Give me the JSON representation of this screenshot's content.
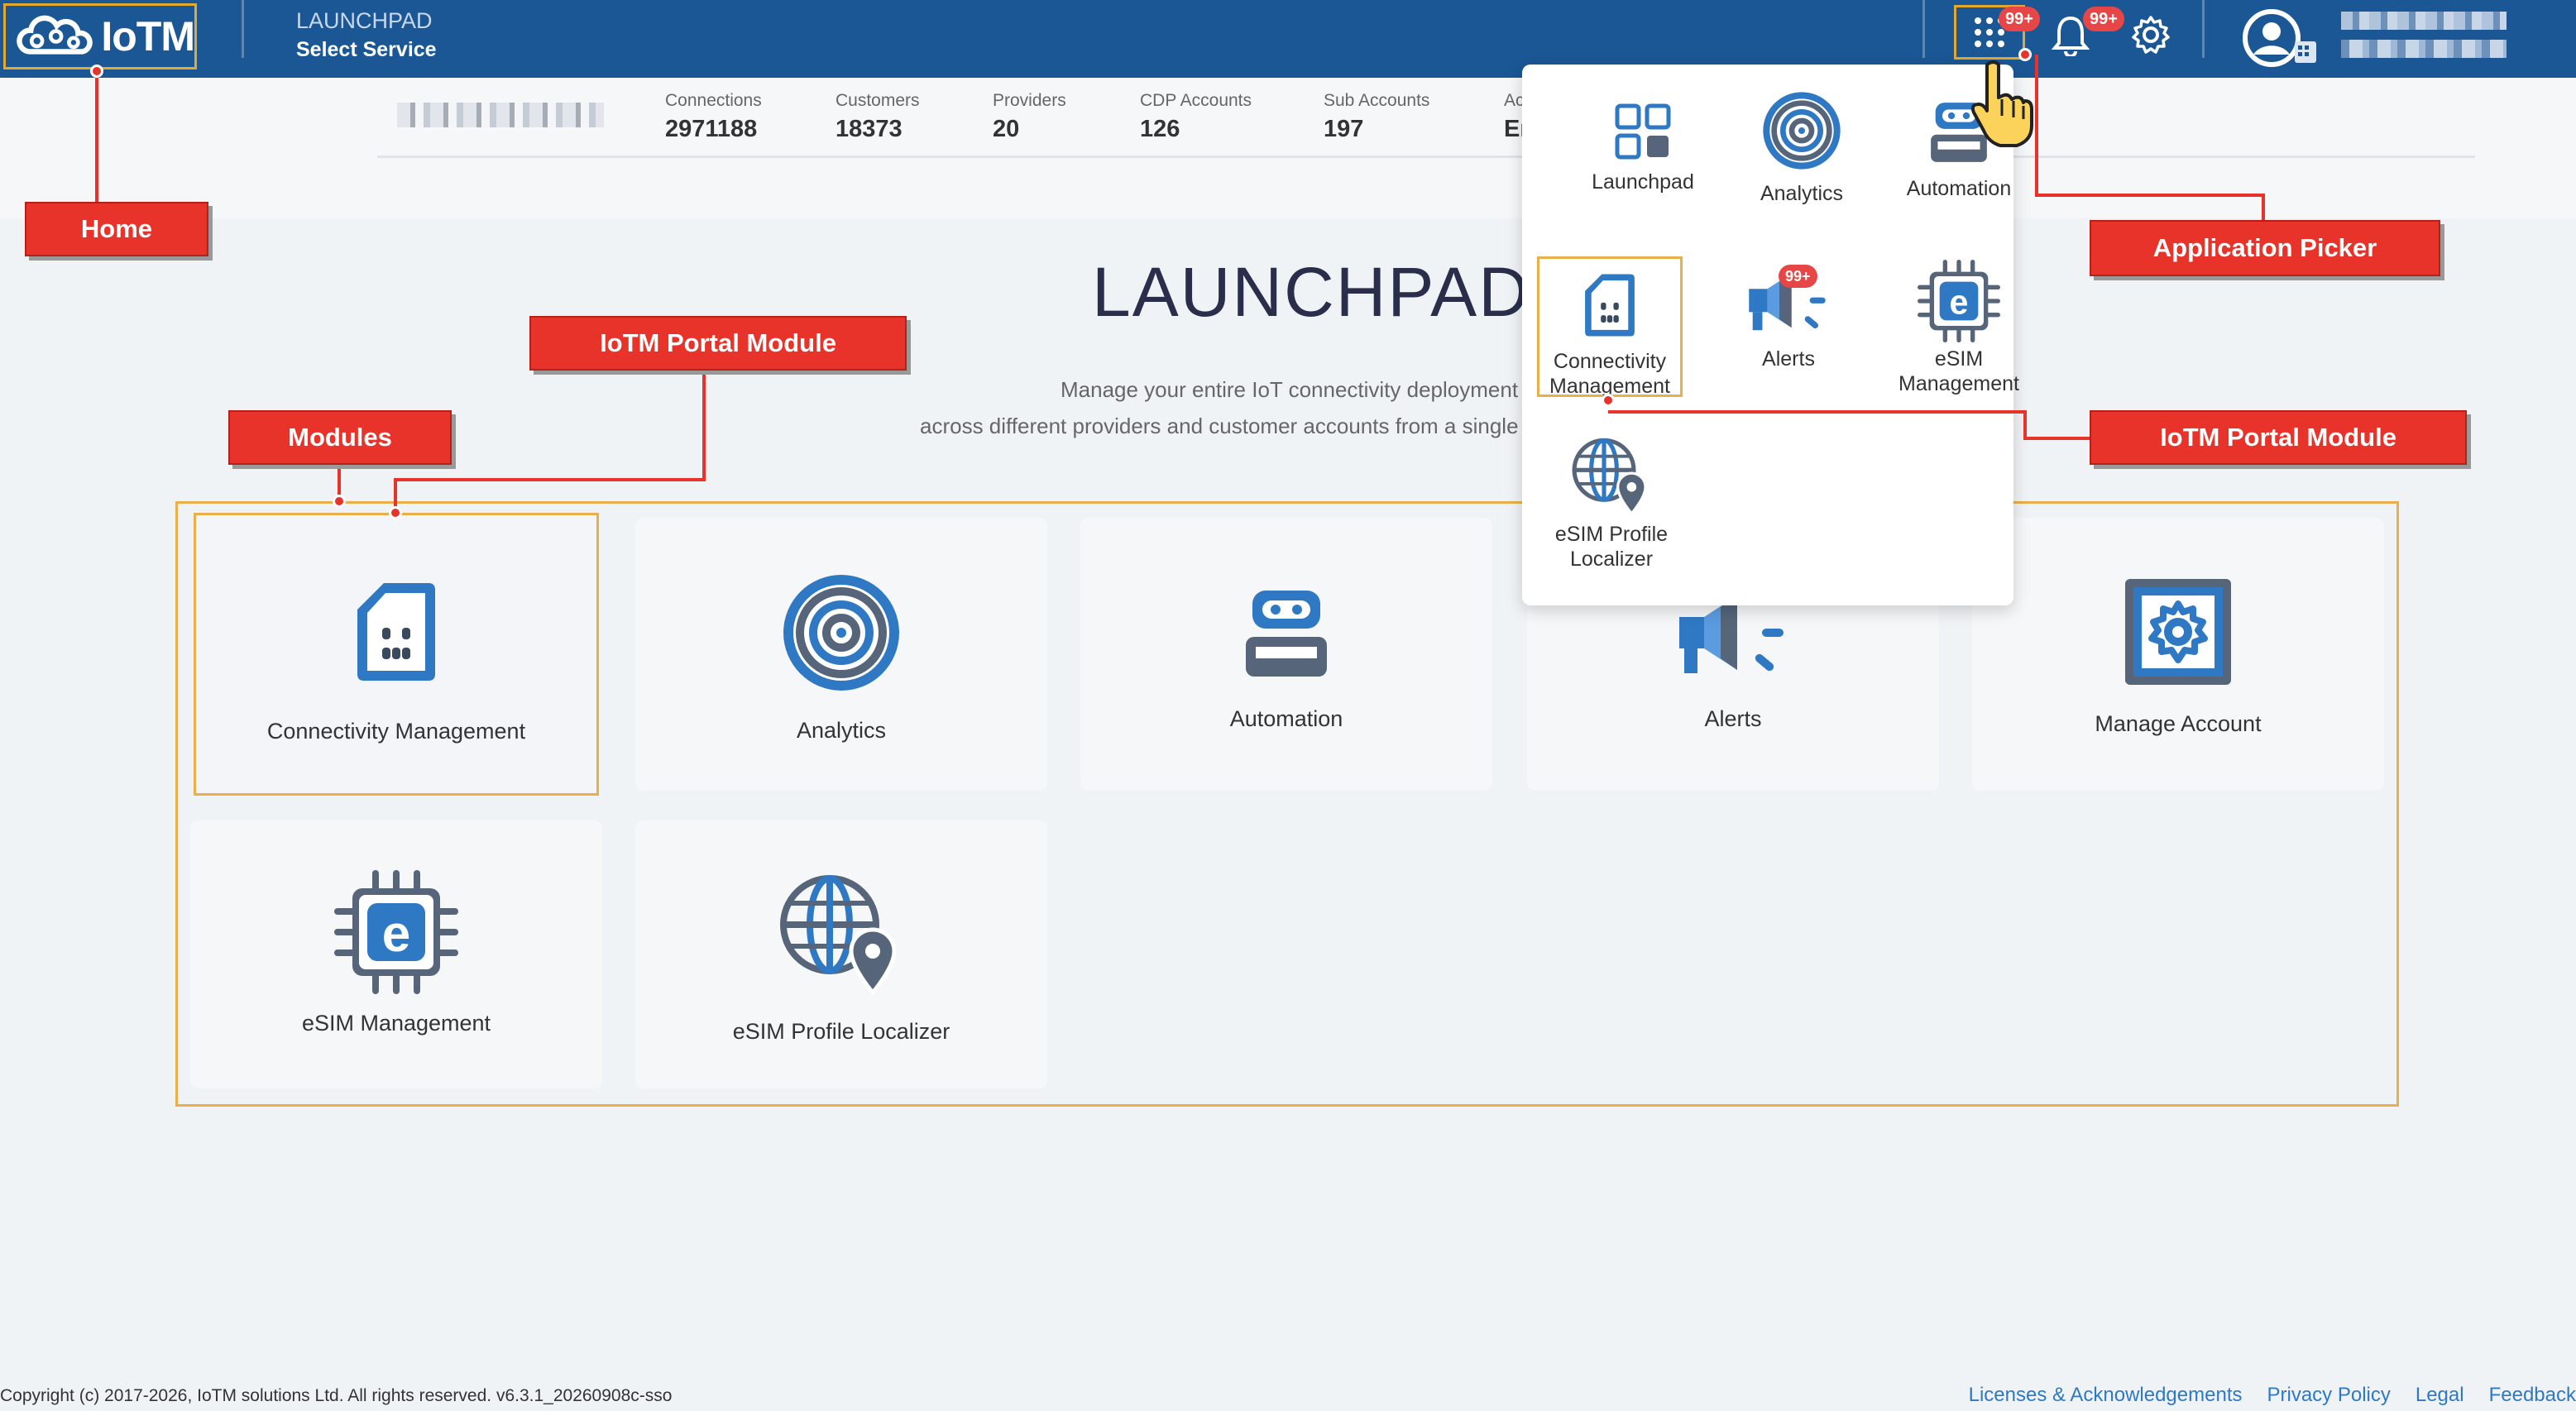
{
  "header": {
    "logo_text": "IoTM",
    "title": "LAUNCHPAD",
    "subtitle": "Select Service",
    "apps_badge": "99+",
    "bell_badge": "99+"
  },
  "stats": [
    {
      "label": "Connections",
      "value": "2971188"
    },
    {
      "label": "Customers",
      "value": "18373"
    },
    {
      "label": "Providers",
      "value": "20"
    },
    {
      "label": "CDP Accounts",
      "value": "126"
    },
    {
      "label": "Sub Accounts",
      "value": "197"
    },
    {
      "label": "Ac",
      "value": "En"
    }
  ],
  "main": {
    "title": "LAUNCHPAD",
    "desc_line1": "Manage your entire IoT connectivity deployment",
    "desc_line2": "across different providers and customer accounts from a single"
  },
  "modules": [
    {
      "label": "Connectivity Management",
      "icon": "sim-card-icon"
    },
    {
      "label": "Analytics",
      "icon": "analytics-icon"
    },
    {
      "label": "Automation",
      "icon": "automation-icon"
    },
    {
      "label": "Alerts",
      "icon": "megaphone-icon"
    },
    {
      "label": "Manage Account",
      "icon": "manage-account-icon"
    },
    {
      "label": "eSIM Management",
      "icon": "esim-chip-icon"
    },
    {
      "label": "eSIM Profile Localizer",
      "icon": "globe-pin-icon"
    }
  ],
  "picker": {
    "items": [
      {
        "label": "Launchpad"
      },
      {
        "label": "Analytics"
      },
      {
        "label": "Automation"
      },
      {
        "label": "Connectivity Management"
      },
      {
        "label": "Alerts",
        "badge": "99+"
      },
      {
        "label": "eSIM Management"
      },
      {
        "label": "eSIM Profile Localizer"
      }
    ]
  },
  "callouts": {
    "home": "Home",
    "modules": "Modules",
    "portal_module_left": "IoTM Portal Module",
    "application_picker": "Application Picker",
    "portal_module_right": "IoTM Portal Module"
  },
  "footer": {
    "copyright": "Copyright (c) 2017-2026, IoTM solutions Ltd. All rights reserved. v6.3.1_20260908c-sso",
    "links": [
      "Licenses & Acknowledgements",
      "Privacy Policy",
      "Legal",
      "Feedback"
    ]
  }
}
